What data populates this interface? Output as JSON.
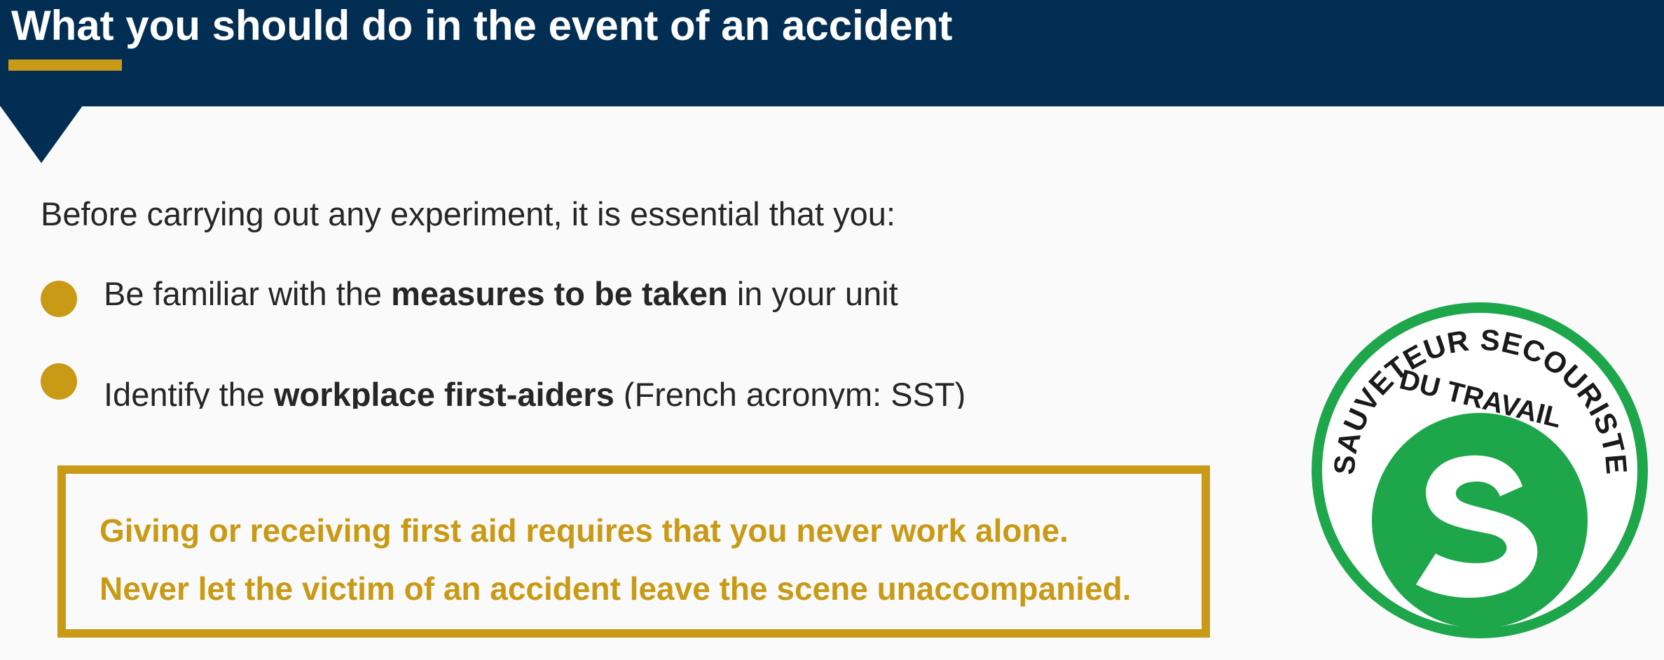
{
  "header": {
    "title": "What you should do in the event of an accident"
  },
  "intro": "Before carrying out any experiment, it is essential that you:",
  "bullets": [
    {
      "before": "Be familiar with the ",
      "bold": "measures to be taken",
      "after": " in your unit"
    },
    {
      "before": "Identify the ",
      "bold": "workplace first-aiders",
      "after": " (French acronym: SST)"
    }
  ],
  "notice": {
    "line1": "Giving or receiving first aid requires that you never work alone.",
    "line2": "Never let the victim of an accident leave the scene unaccompanied."
  },
  "logo": {
    "icon": "sst-first-aider-logo",
    "arc_text": "SAUVETEUR SECOURISTE",
    "inner_text": "DU TRAVAIL",
    "color": "#1ea64b"
  },
  "colors": {
    "header_bg": "#032e54",
    "accent": "#c99a15",
    "text": "#262626"
  }
}
